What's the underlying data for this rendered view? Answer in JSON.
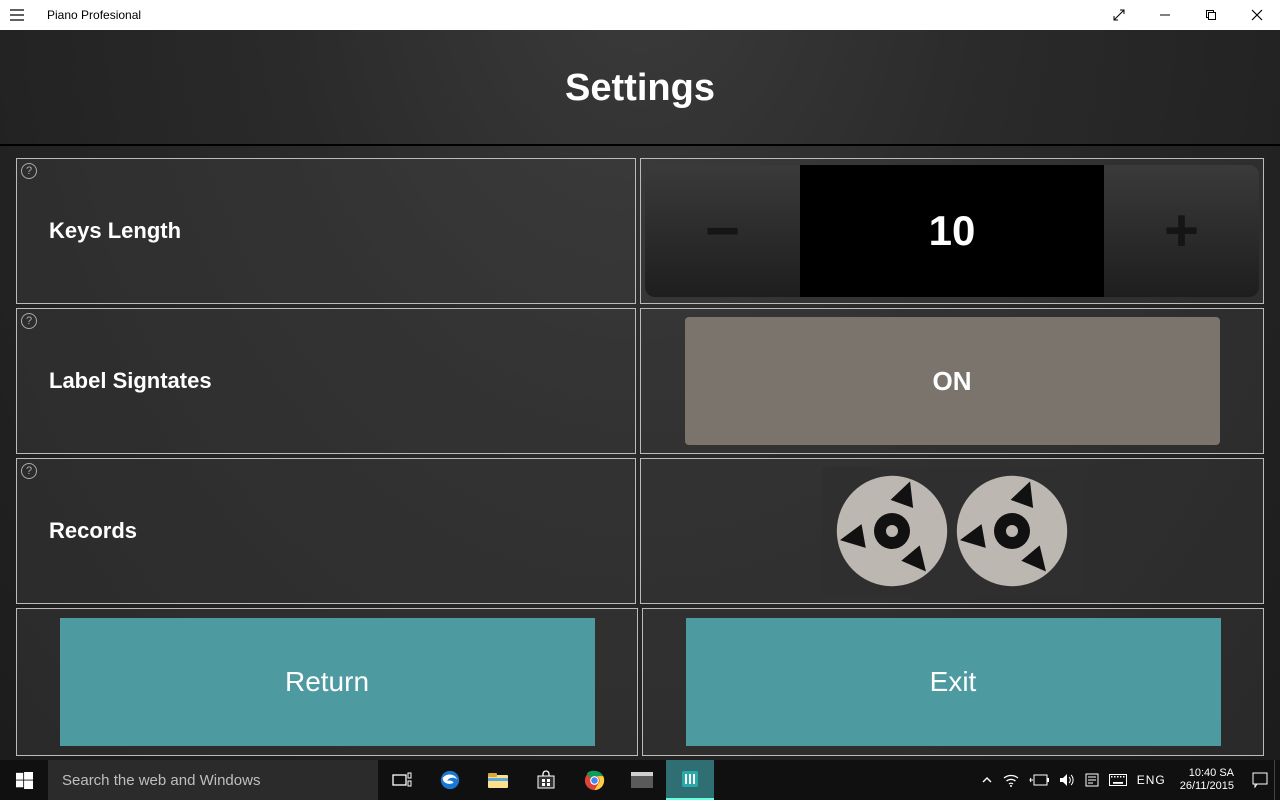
{
  "window": {
    "app_title": "Piano Profesional"
  },
  "header": {
    "title": "Settings"
  },
  "settings": {
    "keys_length": {
      "label": "Keys Length",
      "value": "10"
    },
    "label_signatures": {
      "label": "Label Signtates",
      "state": "ON"
    },
    "records": {
      "label": "Records"
    }
  },
  "actions": {
    "return_label": "Return",
    "exit_label": "Exit"
  },
  "taskbar": {
    "search_placeholder": "Search the web and Windows",
    "language": "ENG",
    "time": "10:40 SA",
    "date": "26/11/2015"
  }
}
